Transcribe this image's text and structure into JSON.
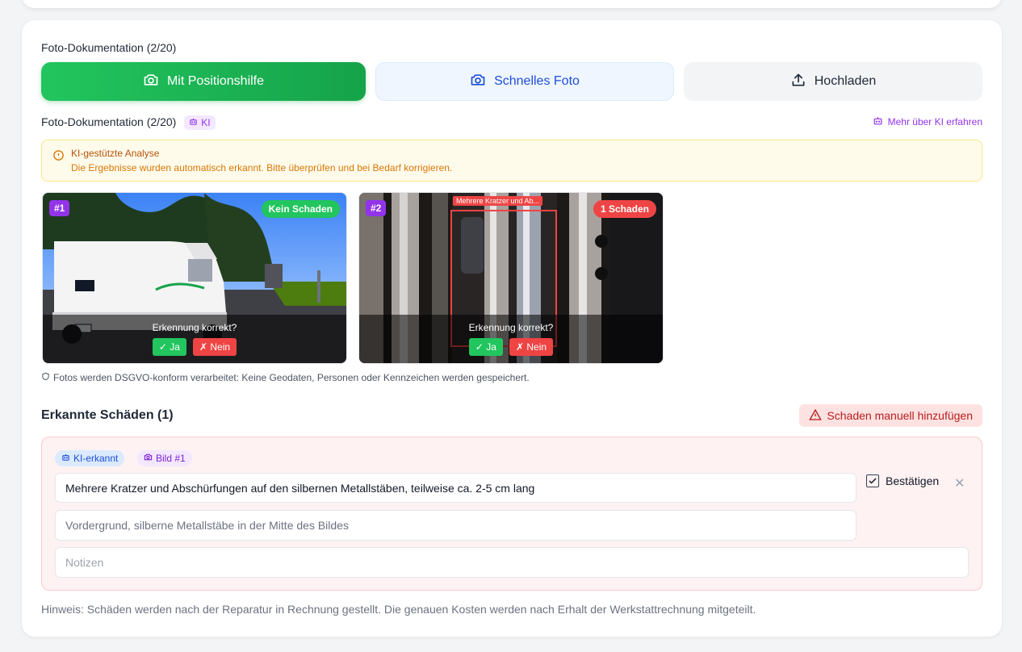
{
  "photos_section": {
    "heading": "Foto-Dokumentation (2/20)",
    "buttons": {
      "guided": "Mit Positionshilfe",
      "quick": "Schnelles Foto",
      "upload": "Hochladen"
    }
  },
  "ki_section": {
    "heading": "Foto-Dokumentation (2/20)",
    "ki_badge": "KI",
    "more_link": "Mehr über KI erfahren",
    "alert": {
      "title": "KI-gestützte Analyse",
      "text": "Die Ergebnisse wurden automatisch erkannt. Bitte überprüfen und bei Bedarf korrigieren."
    },
    "photos": [
      {
        "number": "#1",
        "status": "Kein Schaden",
        "status_color": "#22c55e",
        "question": "Erkennung korrekt?",
        "yes": "✓ Ja",
        "no": "✗ Nein"
      },
      {
        "number": "#2",
        "status": "1 Schaden",
        "status_color": "#ef4444",
        "question": "Erkennung korrekt?",
        "yes": "✓ Ja",
        "no": "✗ Nein",
        "detection_label": "Mehrere Kratzer und Ab..."
      }
    ],
    "privacy_note": "Fotos werden DSGVO-konform verarbeitet: Keine Geodaten, Personen oder Kennzeichen werden gespeichert."
  },
  "damages": {
    "heading": "Erkannte Schäden (1)",
    "add_button": "Schaden manuell hinzufügen",
    "items": [
      {
        "tag_ki": "KI-erkannt",
        "tag_image": "Bild #1",
        "description": "Mehrere Kratzer und Abschürfungen auf den silbernen Metallstäben, teilweise ca. 2-5 cm lang",
        "location": "Vordergrund, silberne Metallstäbe in der Mitte des Bildes",
        "notes_placeholder": "Notizen",
        "confirm_label": "Bestätigen",
        "confirmed": true
      }
    ]
  },
  "hint": "Hinweis: Schäden werden nach der Reparatur in Rechnung gestellt. Die genauen Kosten werden nach Erhalt der Werkstattrechnung mitgeteilt.",
  "colors": {
    "primary_green": "#16a34a",
    "ki_purple": "#9333ea",
    "danger_red": "#ef4444",
    "warning_amber": "#d97706"
  }
}
